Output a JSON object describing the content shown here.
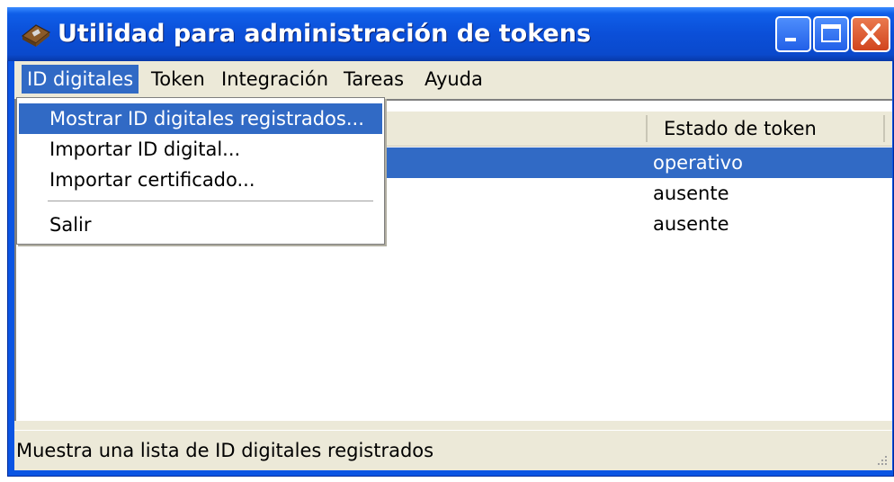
{
  "window": {
    "title": "Utilidad para administración de tokens",
    "controls": {
      "minimize_icon": "minimize-icon",
      "maximize_icon": "maximize-icon",
      "close_icon": "close-icon"
    }
  },
  "menubar": {
    "items": [
      "ID digitales",
      "Token",
      "Integración",
      "Tareas",
      "Ayuda"
    ]
  },
  "dropdown": {
    "items": [
      "Mostrar ID digitales registrados...",
      "Importar ID digital...",
      "Importar certificado...",
      "Salir"
    ],
    "highlighted_index": 0
  },
  "list": {
    "columns": [
      "Estado de token"
    ],
    "rows": [
      {
        "estado": "operativo",
        "selected": true
      },
      {
        "estado": "ausente",
        "selected": false
      },
      {
        "estado": "ausente",
        "selected": false
      }
    ]
  },
  "statusbar": {
    "text": "Muestra una lista de ID digitales registrados"
  },
  "colors": {
    "titlebar": "#0b4fd8",
    "selection": "#316ac5",
    "face": "#ece9d8",
    "close_button": "#d1451e"
  }
}
